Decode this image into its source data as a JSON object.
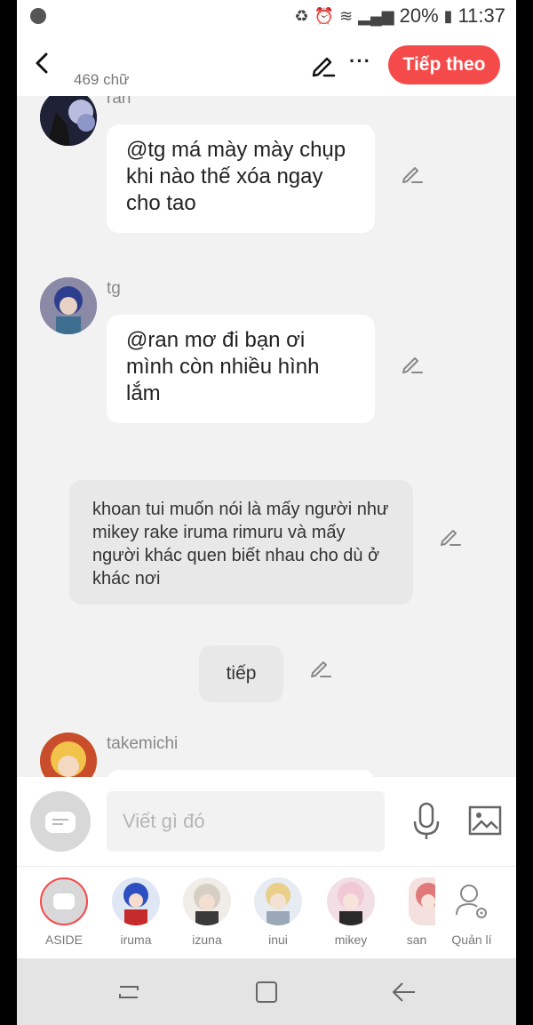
{
  "status_bar": {
    "battery": "20%",
    "time": "11:37"
  },
  "header": {
    "word_count": "469 chữ",
    "next_label": "Tiếp theo"
  },
  "messages": [
    {
      "sender": "ran",
      "text": "@tg má mày mày chụp khi nào thế xóa ngay cho tao"
    },
    {
      "sender": "tg",
      "text": "@ran mơ đi bạn ơi mình còn nhiều hình lắm"
    },
    {
      "narration": "khoan tui muốn nói là mấy người như mikey rake iruma rimuru và mấy người khác quen biết nhau cho dù ở khác nơi"
    },
    {
      "narration": "tiếp"
    },
    {
      "sender": "takemichi"
    }
  ],
  "input": {
    "placeholder": "Viết gì đó"
  },
  "characters": [
    {
      "name": "ASIDE"
    },
    {
      "name": "iruma"
    },
    {
      "name": "izuna"
    },
    {
      "name": "inui"
    },
    {
      "name": "mikey"
    },
    {
      "name": "san"
    },
    {
      "name": "Quản lí"
    }
  ],
  "colors": {
    "accent": "#f54a4a",
    "background": "#f2f2f2"
  }
}
